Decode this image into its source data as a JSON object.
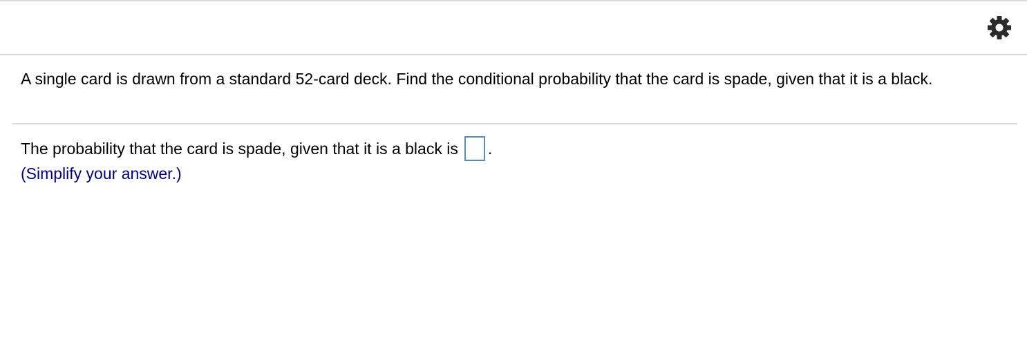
{
  "toolbar": {
    "settings_icon": "gear-icon",
    "icon_color": "#2b2b2b"
  },
  "question": {
    "text": "A single card is drawn from a standard 52-card deck. Find the conditional probability that the card is spade, given that it is a black."
  },
  "answer": {
    "prefix": "The probability that the card is spade, given that it is a black is",
    "input_value": "",
    "suffix": ".",
    "hint": "(Simplify your answer.)"
  },
  "colors": {
    "hint_text": "#000080",
    "input_border": "#5b8ab5",
    "divider": "#d5d5e0"
  }
}
